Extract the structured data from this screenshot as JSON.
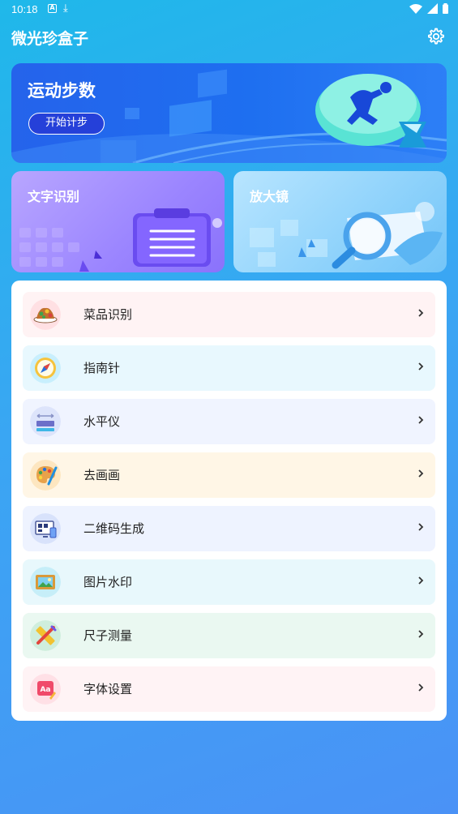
{
  "status": {
    "time": "10:18",
    "a_icon": "A"
  },
  "header": {
    "title": "微光珍盒子"
  },
  "cards": {
    "steps": {
      "title": "运动步数",
      "button": "开始计步"
    },
    "ocr": {
      "title": "文字识别"
    },
    "magnifier": {
      "title": "放大镜"
    }
  },
  "list": [
    {
      "label": "菜品识别",
      "icon": "dish-icon",
      "bg": "#fff3f4"
    },
    {
      "label": "指南针",
      "icon": "compass-icon",
      "bg": "#e8f8fe"
    },
    {
      "label": "水平仪",
      "icon": "level-icon",
      "bg": "#f0f4ff"
    },
    {
      "label": "去画画",
      "icon": "palette-icon",
      "bg": "#fff6e6"
    },
    {
      "label": "二维码生成",
      "icon": "qrcode-icon",
      "bg": "#eef3ff"
    },
    {
      "label": "图片水印",
      "icon": "picture-frame-icon",
      "bg": "#e8f8fc"
    },
    {
      "label": "尺子测量",
      "icon": "ruler-icon",
      "bg": "#eaf8f1"
    },
    {
      "label": "字体设置",
      "icon": "font-icon",
      "bg": "#fff3f5"
    }
  ],
  "colors": {
    "accent": "#2563eb",
    "button": "#2540d9"
  }
}
